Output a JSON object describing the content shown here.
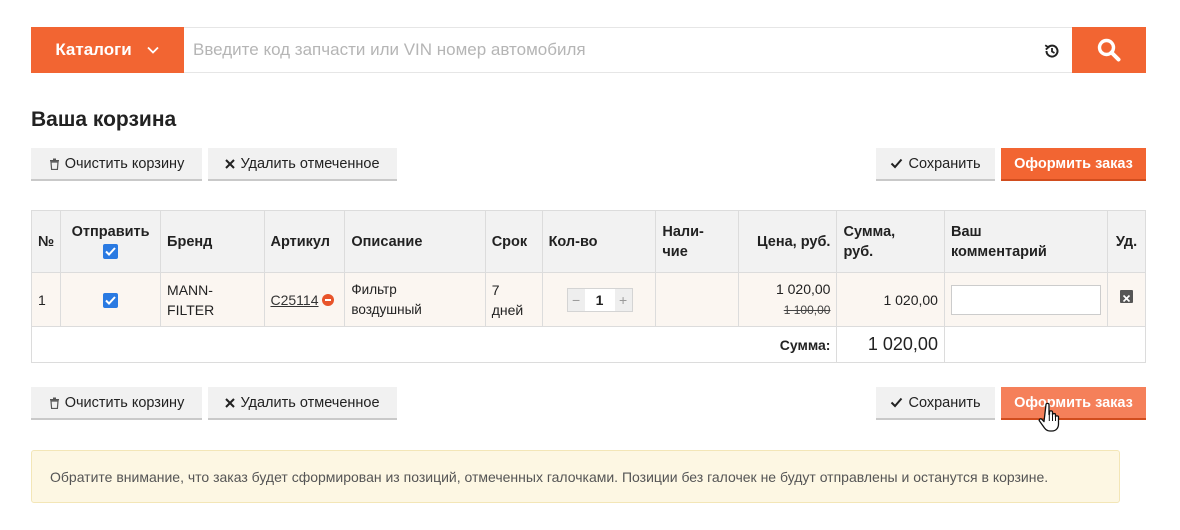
{
  "search": {
    "catalog_label": "Каталоги",
    "placeholder": "Введите код запчасти или VIN номер автомобиля"
  },
  "page": {
    "title": "Ваша корзина"
  },
  "toolbar": {
    "clear_label": "Очистить корзину",
    "delete_selected_label": "Удалить отмеченное",
    "save_label": "Сохранить",
    "checkout_label": "Оформить заказ"
  },
  "table": {
    "headers": {
      "num": "№",
      "send": "Отправить",
      "brand": "Бренд",
      "article": "Артикул",
      "description": "Описание",
      "term": "Срок",
      "qty": "Кол-во",
      "availability_1": "Нали-",
      "availability_2": "чие",
      "price": "Цена, руб.",
      "sum_1": "Сумма,",
      "sum_2": "руб.",
      "comment_1": "Ваш",
      "comment_2": "комментарий",
      "delete": "Уд."
    },
    "rows": [
      {
        "num": "1",
        "checked": true,
        "brand_1": "MANN-",
        "brand_2": "FILTER",
        "article": "C25114",
        "description_1": "Фильтр",
        "description_2": "воздушный",
        "term_1": "7",
        "term_2": "дней",
        "qty": "1",
        "availability": "",
        "price": "1 020,00",
        "old_price": "1 100,00",
        "sum": "1 020,00",
        "comment": ""
      }
    ],
    "total_label": "Сумма:",
    "total_value": "1 020,00"
  },
  "notice": {
    "text": "Обратите внимание, что заказ будет сформирован из позиций, отмеченных галочками. Позиции без галочек не будут отправлены и останутся в корзине."
  },
  "colors": {
    "accent": "#f26532",
    "checkbox": "#2a7ae2",
    "notice_bg": "#fdf7e3"
  }
}
